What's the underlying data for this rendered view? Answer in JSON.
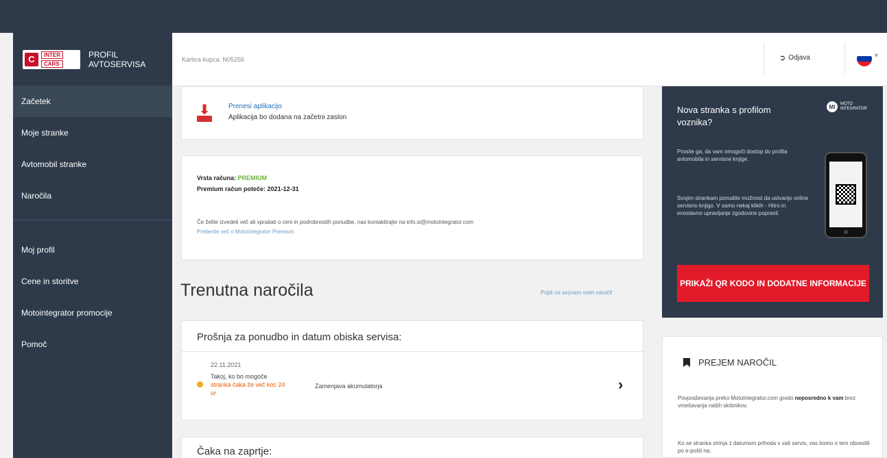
{
  "sidebar": {
    "logo_mark": "C",
    "logo_line1": "INTER",
    "logo_line2": "CARS",
    "brand_line1": "PROFIL",
    "brand_line2": "AVTOSERVISA",
    "items": [
      {
        "label": "Začetek",
        "active": true
      },
      {
        "label": "Moje stranke"
      },
      {
        "label": "Avtomobil stranke"
      },
      {
        "label": "Naročila"
      },
      {
        "label": "Moj profil"
      },
      {
        "label": "Cene in storitve"
      },
      {
        "label": "Motointegrator promocije"
      },
      {
        "label": "Pomoč"
      }
    ]
  },
  "header": {
    "card_number": "Kartica kupca: N05256",
    "logout_label": "Odjava",
    "language": "sl",
    "flag_colors": [
      "#ffffff",
      "#0038a8",
      "#ed1c24"
    ]
  },
  "download": {
    "icon": "download-icon",
    "title": "Prenesi aplikacijo",
    "subtitle": "Aplikacija bo dodana na začetni zaslon"
  },
  "account": {
    "type_label": "Vrsta računa:",
    "type_value": "PREMIUM",
    "expire_label": "Premium račun poteče:",
    "expire_value": "2021-12-31",
    "info_text": "Če želite izvedeti več ali vprašati o ceni in podrobnostih ponudbe, nas kontaktirajte na info.si@motointegrator.com",
    "learn_more": "Preberite več o Motointegrator Premium"
  },
  "current_orders": {
    "title": "Trenutna naročila",
    "list_link": "Pojdi na seznam vseh naročil"
  },
  "request": {
    "title": "Prošnja za ponudbo in datum obiska servisa:",
    "order": {
      "date": "22.11.2021",
      "status_text": "Takoj, ko bo mogoče",
      "status_late": "stranka čaka že več koc 24 ur",
      "service": "Zamenjava akumulatorja",
      "status_color": "#f5a623"
    }
  },
  "waiting": {
    "title": "Čaka na zaprtje:"
  },
  "promo": {
    "title": "Nova stranka s profilom voznika?",
    "logo_mark": "MI",
    "logo_text1": "MOTO",
    "logo_text2": "INTEGRATOR",
    "text1": "Prosite ga, da vam omogoči dostop do profila avtomobila in servisne knjige.",
    "text2": "Svojim strankam ponudite možnost da ustvarijo online servisno knjigo. V samo nekaj klikih - Hitro in enostavno upravljanje zgodovine popravil.",
    "button_label": "PRIKAŽI QR KODO IN DODATNE INFORMACIJE",
    "button_color": "#e11b2a"
  },
  "orders_info": {
    "title": "PREJEM NAROČIL",
    "text1_before": "Povpraševanja preko Motointegrator.com gredo ",
    "text1_bold": "neposredno k vam",
    "text1_after": " brez vmešavanja naših skrbnikov.",
    "text2": "Ko se stranka strinja z datumom prihoda v vaš servis, vas bomo o tem obvestili po e-pošti na:"
  }
}
